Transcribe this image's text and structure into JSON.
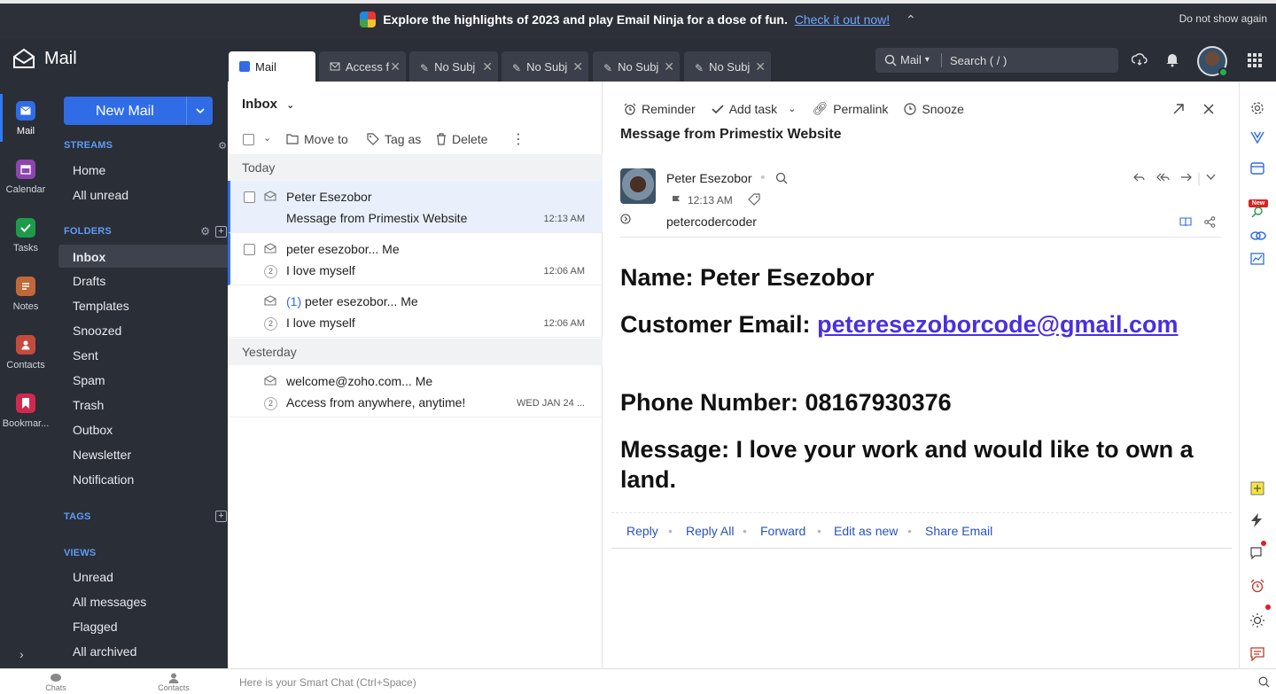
{
  "banner": {
    "text": "Explore the highlights of 2023 and play Email Ninja for a dose of fun.",
    "link": "Check it out now!",
    "dismiss": "Do not show again"
  },
  "app": {
    "title": "Mail"
  },
  "tabs": [
    {
      "label": "Mail",
      "icon": "mail-icon",
      "active": true
    },
    {
      "label": "Access f",
      "icon": "envelope-icon"
    },
    {
      "label": "No Subj",
      "icon": "pencil-icon"
    },
    {
      "label": "No Subj",
      "icon": "pencil-icon"
    },
    {
      "label": "No Subj",
      "icon": "pencil-icon"
    },
    {
      "label": "No Subj",
      "icon": "pencil-icon"
    }
  ],
  "search": {
    "scope": "Mail",
    "placeholder": "Search ( / )"
  },
  "rail": {
    "mail": "Mail",
    "calendar": "Calendar",
    "tasks": "Tasks",
    "notes": "Notes",
    "contacts": "Contacts",
    "bookmarks": "Bookmar..."
  },
  "sidebar": {
    "new_mail": "New Mail",
    "streams_heading": "STREAMS",
    "streams": [
      "Home",
      "All unread"
    ],
    "folders_heading": "FOLDERS",
    "folders": [
      "Inbox",
      "Drafts",
      "Templates",
      "Snoozed",
      "Sent",
      "Spam",
      "Trash",
      "Outbox",
      "Newsletter",
      "Notification"
    ],
    "tags_heading": "TAGS",
    "views_heading": "VIEWS",
    "views": [
      "Unread",
      "All messages",
      "Flagged",
      "All archived"
    ]
  },
  "list": {
    "title": "Inbox",
    "toolbar": {
      "move": "Move to",
      "tag": "Tag as",
      "delete": "Delete"
    },
    "groups": {
      "today": "Today",
      "yesterday": "Yesterday"
    },
    "messages": [
      {
        "from": "Peter Esezobor",
        "subject": "Message from Primestix Website",
        "time": "12:13 AM"
      },
      {
        "from": "peter esezobor... Me",
        "subject": "I love myself",
        "time": "12:06 AM",
        "count": "2"
      },
      {
        "thread": "(1)",
        "from": "peter esezobor... Me",
        "subject": "I love myself",
        "time": "12:06 AM",
        "count": "2"
      },
      {
        "from": "welcome@zoho.com... Me",
        "subject": "Access from anywhere, anytime!",
        "time": "WED JAN 24 ...",
        "count": "2"
      }
    ]
  },
  "reader": {
    "actions": {
      "reminder": "Reminder",
      "add_task": "Add task",
      "permalink": "Permalink",
      "snooze": "Snooze"
    },
    "subject": "Message from Primestix Website",
    "sender": {
      "name": "Peter Esezobor",
      "time": "12:13 AM",
      "to": "petercodercoder"
    },
    "body": {
      "name": "Name: Peter Esezobor",
      "email_label": "Customer Email:",
      "email": "peteresezoborcode@gmail.com",
      "phone": "Phone Number: 08167930376",
      "message_line1": "Message: I love your work and would like to own a",
      "message_line2": "land."
    },
    "reply_actions": [
      "Reply",
      "Reply All",
      "Forward",
      "Edit as new",
      "Share Email"
    ]
  },
  "bottom": {
    "chats": "Chats",
    "contacts": "Contacts",
    "smartchat": "Here is your Smart Chat (Ctrl+Space)"
  },
  "right_strip": {
    "new_badge": "New"
  },
  "colors": {
    "accent": "#2f6ce5",
    "dark": "#2a2e37",
    "banner_red": "#d9211c",
    "link": "#4a2fe0"
  }
}
